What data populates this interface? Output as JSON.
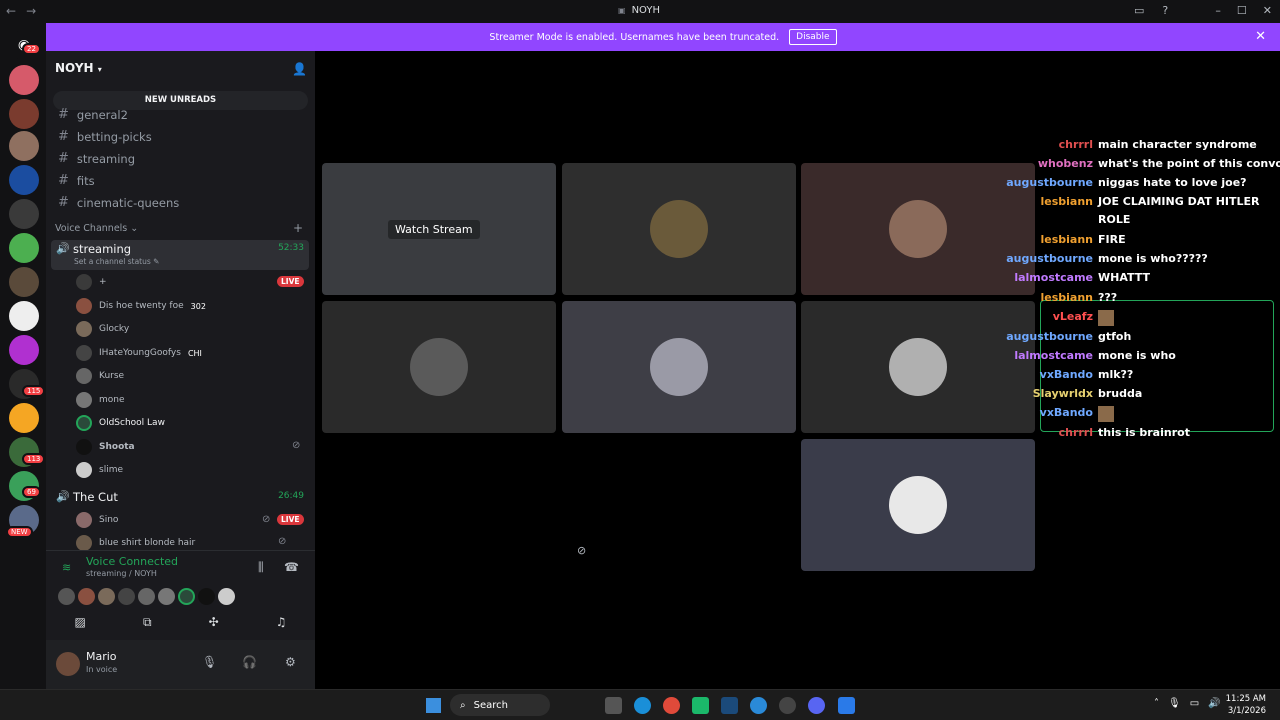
{
  "window": {
    "title": "NOYH",
    "back": "←",
    "forward": "→"
  },
  "banner": {
    "text": "Streamer Mode is enabled. Usernames have been truncated.",
    "button": "Disable",
    "close": "✕"
  },
  "server_badges": {
    "top": "22",
    "b1": "115",
    "b2": "113",
    "b3": "69",
    "new": "NEW"
  },
  "server": {
    "name": "NOYH",
    "new_unreads": "NEW UNREADS"
  },
  "text_channels": [
    "general2",
    "betting-picks",
    "streaming",
    "fits",
    "cinematic-queens"
  ],
  "voice_category": "Voice Channels",
  "voice_channels": [
    {
      "name": "streaming",
      "time": "52:33",
      "status": "Set a channel status ✎"
    },
    {
      "name": "The Cut",
      "time": "26:49"
    }
  ],
  "voice_users": [
    {
      "name": "+",
      "live": "LIVE"
    },
    {
      "name": "Dis hoe twenty foe",
      "extra": "302"
    },
    {
      "name": "Glocky"
    },
    {
      "name": "IHateYoungGoofys",
      "extra": "CHI"
    },
    {
      "name": "Kurse"
    },
    {
      "name": "mone"
    },
    {
      "name": "OldSchool Law"
    },
    {
      "name": "Shoota"
    },
    {
      "name": "slime"
    }
  ],
  "cut_users": [
    {
      "name": "Sino",
      "live": "LIVE"
    },
    {
      "name": "blue shirt blonde hair"
    }
  ],
  "voice_panel": {
    "title": "Voice Connected",
    "sub": "streaming / NOYH"
  },
  "user": {
    "name": "Mario",
    "status": "In voice"
  },
  "stage": {
    "watch_stream": "Watch Stream"
  },
  "chat": [
    {
      "who": "chrrrl",
      "text": "main character syndrome",
      "color": "#e05050"
    },
    {
      "who": "whobenz",
      "text": "what's the point of this convo",
      "color": "#e070c0"
    },
    {
      "who": "augustbourne",
      "text": "niggas hate to love joe?",
      "color": "#6fa8ff"
    },
    {
      "who": "lesbiann",
      "text": "JOE CLAIMING DAT HITLER",
      "color": "#f0a030"
    },
    {
      "who": "",
      "text": "ROLE",
      "color": "#f0a030"
    },
    {
      "who": "lesbiann",
      "text": "FIRE",
      "color": "#f0a030"
    },
    {
      "who": "augustbourne",
      "text": "mone is who?????",
      "color": "#6fa8ff"
    },
    {
      "who": "lalmostcame",
      "text": "WHATTT",
      "color": "#c07aff"
    },
    {
      "who": "lesbiann",
      "text": "???",
      "color": "#f0a030"
    },
    {
      "who": "vLeafz",
      "text": "",
      "color": "#ff5050"
    },
    {
      "who": "augustbourne",
      "text": "gtfoh",
      "color": "#6fa8ff"
    },
    {
      "who": "lalmostcame",
      "text": "mone is who",
      "color": "#c07aff"
    },
    {
      "who": "vxBando",
      "text": "mlk??",
      "color": "#6fa8ff"
    },
    {
      "who": "Slaywrldx",
      "text": "brudda",
      "color": "#e6d070"
    },
    {
      "who": "vxBando",
      "text": "",
      "color": "#6fa8ff"
    },
    {
      "who": "chrrrl",
      "text": "this is brainrot",
      "color": "#e05050"
    }
  ],
  "taskbar": {
    "search": "Search",
    "time": "11:25 AM",
    "date": "3/1/2026"
  }
}
